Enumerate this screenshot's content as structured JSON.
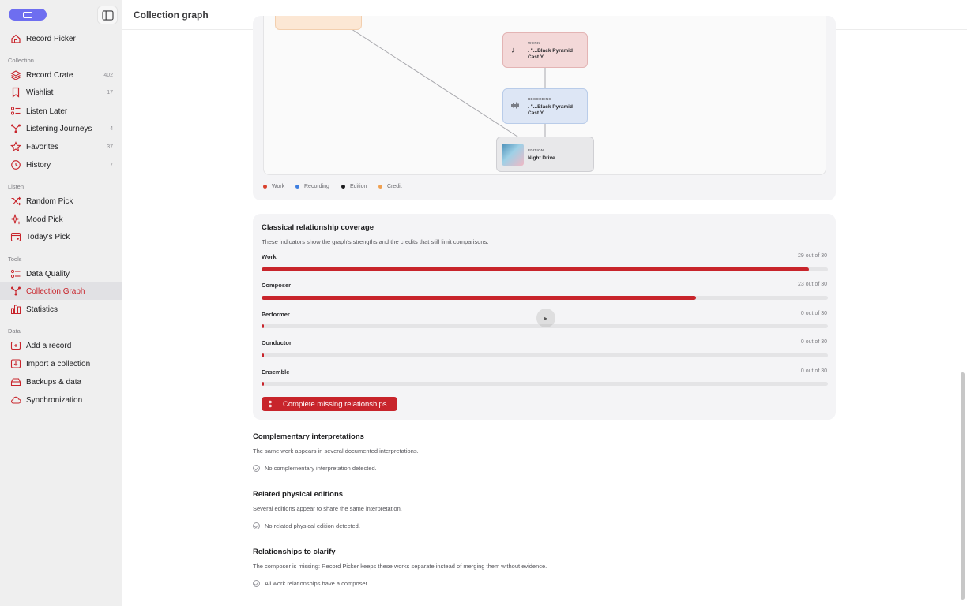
{
  "app": {
    "title": "Record Picker"
  },
  "sidebar": {
    "top_item": {
      "label": "Record Picker",
      "icon": "home-icon"
    },
    "sections": {
      "collection": "Collection",
      "listen": "Listen",
      "tools": "Tools",
      "data": "Data"
    },
    "collection_items": [
      {
        "label": "Record Crate",
        "count": "402",
        "icon": "layers-icon"
      },
      {
        "label": "Wishlist",
        "count": "17",
        "icon": "bookmark-icon"
      },
      {
        "label": "Listen Later",
        "count": "",
        "icon": "list-icon"
      },
      {
        "label": "Listening Journeys",
        "count": "4",
        "icon": "network-icon"
      },
      {
        "label": "Favorites",
        "count": "37",
        "icon": "star-icon"
      },
      {
        "label": "History",
        "count": "7",
        "icon": "history-icon"
      }
    ],
    "listen_items": [
      {
        "label": "Random Pick",
        "icon": "shuffle-icon"
      },
      {
        "label": "Mood Pick",
        "icon": "sparkles-icon"
      },
      {
        "label": "Today's Pick",
        "icon": "calendar-icon"
      }
    ],
    "tools_items": [
      {
        "label": "Data Quality",
        "icon": "checklist-icon"
      },
      {
        "label": "Collection Graph",
        "icon": "graph-icon",
        "active": true
      },
      {
        "label": "Statistics",
        "icon": "bar-chart-icon"
      }
    ],
    "data_items": [
      {
        "label": "Add a record",
        "icon": "add-record-icon"
      },
      {
        "label": "Import a collection",
        "icon": "import-icon"
      },
      {
        "label": "Backups & data",
        "icon": "archive-icon"
      },
      {
        "label": "Synchronization",
        "icon": "cloud-icon"
      }
    ]
  },
  "header": {
    "title": "Collection graph"
  },
  "graph": {
    "nodes": [
      {
        "kind": "WORK",
        "label": ". \"...Black Pyramid Cast Y...",
        "icon": "music-note-icon"
      },
      {
        "kind": "RECORDING",
        "label": ". \"...Black Pyramid Cast Y...",
        "icon": "waveform-icon"
      },
      {
        "kind": "EDITION",
        "label": "Night Drive",
        "icon": "album-cover-icon"
      }
    ],
    "legend": [
      {
        "label": "Work",
        "color": "#d9402c"
      },
      {
        "label": "Recording",
        "color": "#3f7fe0"
      },
      {
        "label": "Edition",
        "color": "#1d1d1f"
      },
      {
        "label": "Credit",
        "color": "#f0a050"
      }
    ]
  },
  "coverage": {
    "title": "Classical relationship coverage",
    "subtitle": "These indicators show the graph's strengths and the credits that still limit comparisons.",
    "rows": [
      {
        "label": "Work",
        "count_text": "29 out of 30",
        "value": 29,
        "total": 30
      },
      {
        "label": "Composer",
        "count_text": "23 out of 30",
        "value": 23,
        "total": 30
      },
      {
        "label": "Performer",
        "count_text": "0 out of 30",
        "value": 0,
        "total": 30
      },
      {
        "label": "Conductor",
        "count_text": "0 out of 30",
        "value": 0,
        "total": 30
      },
      {
        "label": "Ensemble",
        "count_text": "0 out of 30",
        "value": 0,
        "total": 30
      }
    ],
    "cta_label": "Complete missing relationships"
  },
  "sections": [
    {
      "title": "Complementary interpretations",
      "description": "The same work appears in several documented interpretations.",
      "status": "No complementary interpretation detected."
    },
    {
      "title": "Related physical editions",
      "description": "Several editions appear to share the same interpretation.",
      "status": "No related physical edition detected."
    },
    {
      "title": "Relationships to clarify",
      "description": "The composer is missing: Record Picker keeps these works separate instead of merging them without evidence.",
      "status": "All work relationships have a composer."
    }
  ]
}
